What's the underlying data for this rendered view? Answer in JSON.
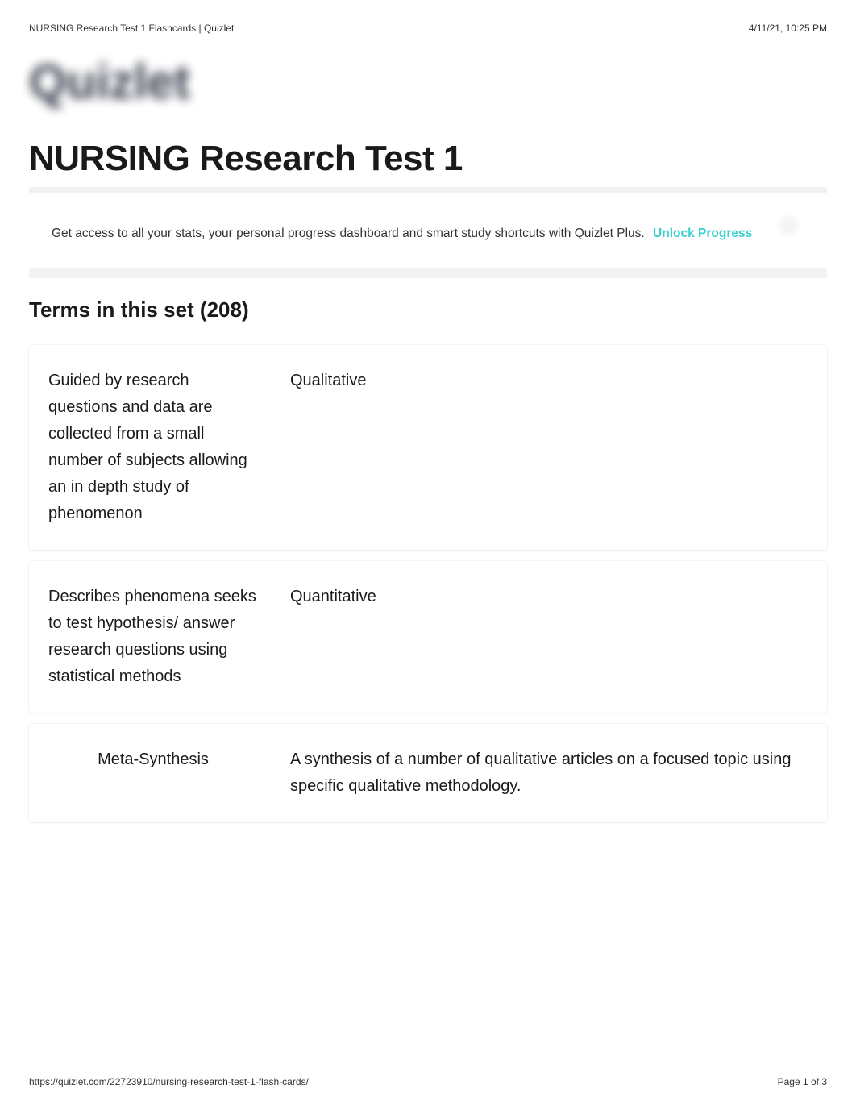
{
  "header": {
    "left": "NURSING Research Test 1 Flashcards | Quizlet",
    "right": "4/11/21, 10:25 PM"
  },
  "logo": {
    "text": "Quizlet"
  },
  "title": "NURSING Research Test 1",
  "promo": {
    "text": "Get access to all your stats, your personal progress dashboard and smart study shortcuts with Quizlet Plus.",
    "link_label": "Unlock Progress"
  },
  "section": {
    "heading": "Terms in this set (208)"
  },
  "cards": [
    {
      "term": "Guided by research questions and data are collected from a small number of subjects allowing an in depth study of phenomenon",
      "definition": "Qualitative"
    },
    {
      "term": "Describes phenomena seeks to test hypothesis/ answer research questions using statistical methods",
      "definition": "Quantitative"
    },
    {
      "term": "Meta-Synthesis",
      "definition": "A synthesis of a number of qualitative articles on a focused topic using specific qualitative methodology."
    }
  ],
  "footer": {
    "left": "https://quizlet.com/22723910/nursing-research-test-1-flash-cards/",
    "right": "Page 1 of 3"
  }
}
